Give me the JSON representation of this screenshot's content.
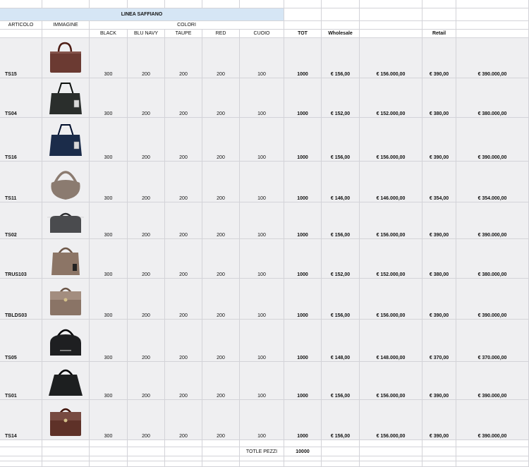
{
  "header": {
    "title": "LINEA SAFFIANO",
    "col_articolo": "ARTICOLO",
    "col_immagine": "IMMAGINE",
    "col_colori": "COLORI",
    "colors": [
      "BLACK",
      "BLU NAVY",
      "TAUPE",
      "RED",
      "CUOIO"
    ],
    "col_tot": "TOT",
    "col_wholesale": "Wholesale",
    "col_retail": "Retail"
  },
  "rows": [
    {
      "code": "TS15",
      "black": "300",
      "blu_navy": "200",
      "taupe": "200",
      "red": "200",
      "cuoio": "100",
      "tot": "1000",
      "wholesale_unit": "€ 156,00",
      "wholesale_total": "€ 156.000,00",
      "retail_unit": "€ 390,00",
      "retail_total": "€ 390.000,00",
      "bag": {
        "style": "tote",
        "color": "#6b3a32"
      }
    },
    {
      "code": "TS04",
      "black": "300",
      "blu_navy": "200",
      "taupe": "200",
      "red": "200",
      "cuoio": "100",
      "tot": "1000",
      "wholesale_unit": "€ 152,00",
      "wholesale_total": "€ 152.000,00",
      "retail_unit": "€ 380,00",
      "retail_total": "€ 380.000,00",
      "bag": {
        "style": "shopper",
        "color": "#2a2e2c"
      }
    },
    {
      "code": "TS16",
      "black": "300",
      "blu_navy": "200",
      "taupe": "200",
      "red": "200",
      "cuoio": "100",
      "tot": "1000",
      "wholesale_unit": "€ 156,00",
      "wholesale_total": "€ 156.000,00",
      "retail_unit": "€ 390,00",
      "retail_total": "€ 390.000,00",
      "bag": {
        "style": "shopper",
        "color": "#1b2c4a"
      }
    },
    {
      "code": "TS11",
      "black": "300",
      "blu_navy": "200",
      "taupe": "200",
      "red": "200",
      "cuoio": "100",
      "tot": "1000",
      "wholesale_unit": "€ 146,00",
      "wholesale_total": "€ 146.000,00",
      "retail_unit": "€ 354,00",
      "retail_total": "€ 354.000,00",
      "bag": {
        "style": "hobo",
        "color": "#8b7b70"
      }
    },
    {
      "code": "TS02",
      "black": "300",
      "blu_navy": "200",
      "taupe": "200",
      "red": "200",
      "cuoio": "100",
      "tot": "1000",
      "wholesale_unit": "€ 156,00",
      "wholesale_total": "€ 156.000,00",
      "retail_unit": "€ 390,00",
      "retail_total": "€ 390.000,00",
      "bag": {
        "style": "duffle",
        "color": "#4a4b4e"
      }
    },
    {
      "code": "TRUS103",
      "black": "300",
      "blu_navy": "200",
      "taupe": "200",
      "red": "200",
      "cuoio": "100",
      "tot": "1000",
      "wholesale_unit": "€ 152,00",
      "wholesale_total": "€ 152.000,00",
      "retail_unit": "€ 380,00",
      "retail_total": "€ 380.000,00",
      "bag": {
        "style": "satchel",
        "color": "#8c7566"
      }
    },
    {
      "code": "TBLDS03",
      "black": "300",
      "blu_navy": "200",
      "taupe": "200",
      "red": "200",
      "cuoio": "100",
      "tot": "1000",
      "wholesale_unit": "€ 156,00",
      "wholesale_total": "€ 156.000,00",
      "retail_unit": "€ 390,00",
      "retail_total": "€ 390.000,00",
      "bag": {
        "style": "flap",
        "color": "#8a7466"
      }
    },
    {
      "code": "TS05",
      "black": "300",
      "blu_navy": "200",
      "taupe": "200",
      "red": "200",
      "cuoio": "100",
      "tot": "1000",
      "wholesale_unit": "€ 148,00",
      "wholesale_total": "€ 148.000,00",
      "retail_unit": "€ 370,00",
      "retail_total": "€ 370.000,00",
      "bag": {
        "style": "bowling",
        "color": "#1e1f21"
      }
    },
    {
      "code": "TS01",
      "black": "300",
      "blu_navy": "200",
      "taupe": "200",
      "red": "200",
      "cuoio": "100",
      "tot": "1000",
      "wholesale_unit": "€ 156,00",
      "wholesale_total": "€ 156.000,00",
      "retail_unit": "€ 390,00",
      "retail_total": "€ 390.000,00",
      "bag": {
        "style": "trapeze",
        "color": "#1d1f20"
      }
    },
    {
      "code": "TS14",
      "black": "300",
      "blu_navy": "200",
      "taupe": "200",
      "red": "200",
      "cuoio": "100",
      "tot": "1000",
      "wholesale_unit": "€ 156,00",
      "wholesale_total": "€ 156.000,00",
      "retail_unit": "€ 390,00",
      "retail_total": "€ 390.000,00",
      "bag": {
        "style": "flap",
        "color": "#5e3128"
      }
    }
  ],
  "footer": {
    "total_label": "TOTLE PEZZI",
    "total_value": "10000"
  },
  "colors": {
    "header_band": "#d6e6f5",
    "cell_fill": "#efeff1",
    "grid_line": "#d3d3d8"
  }
}
